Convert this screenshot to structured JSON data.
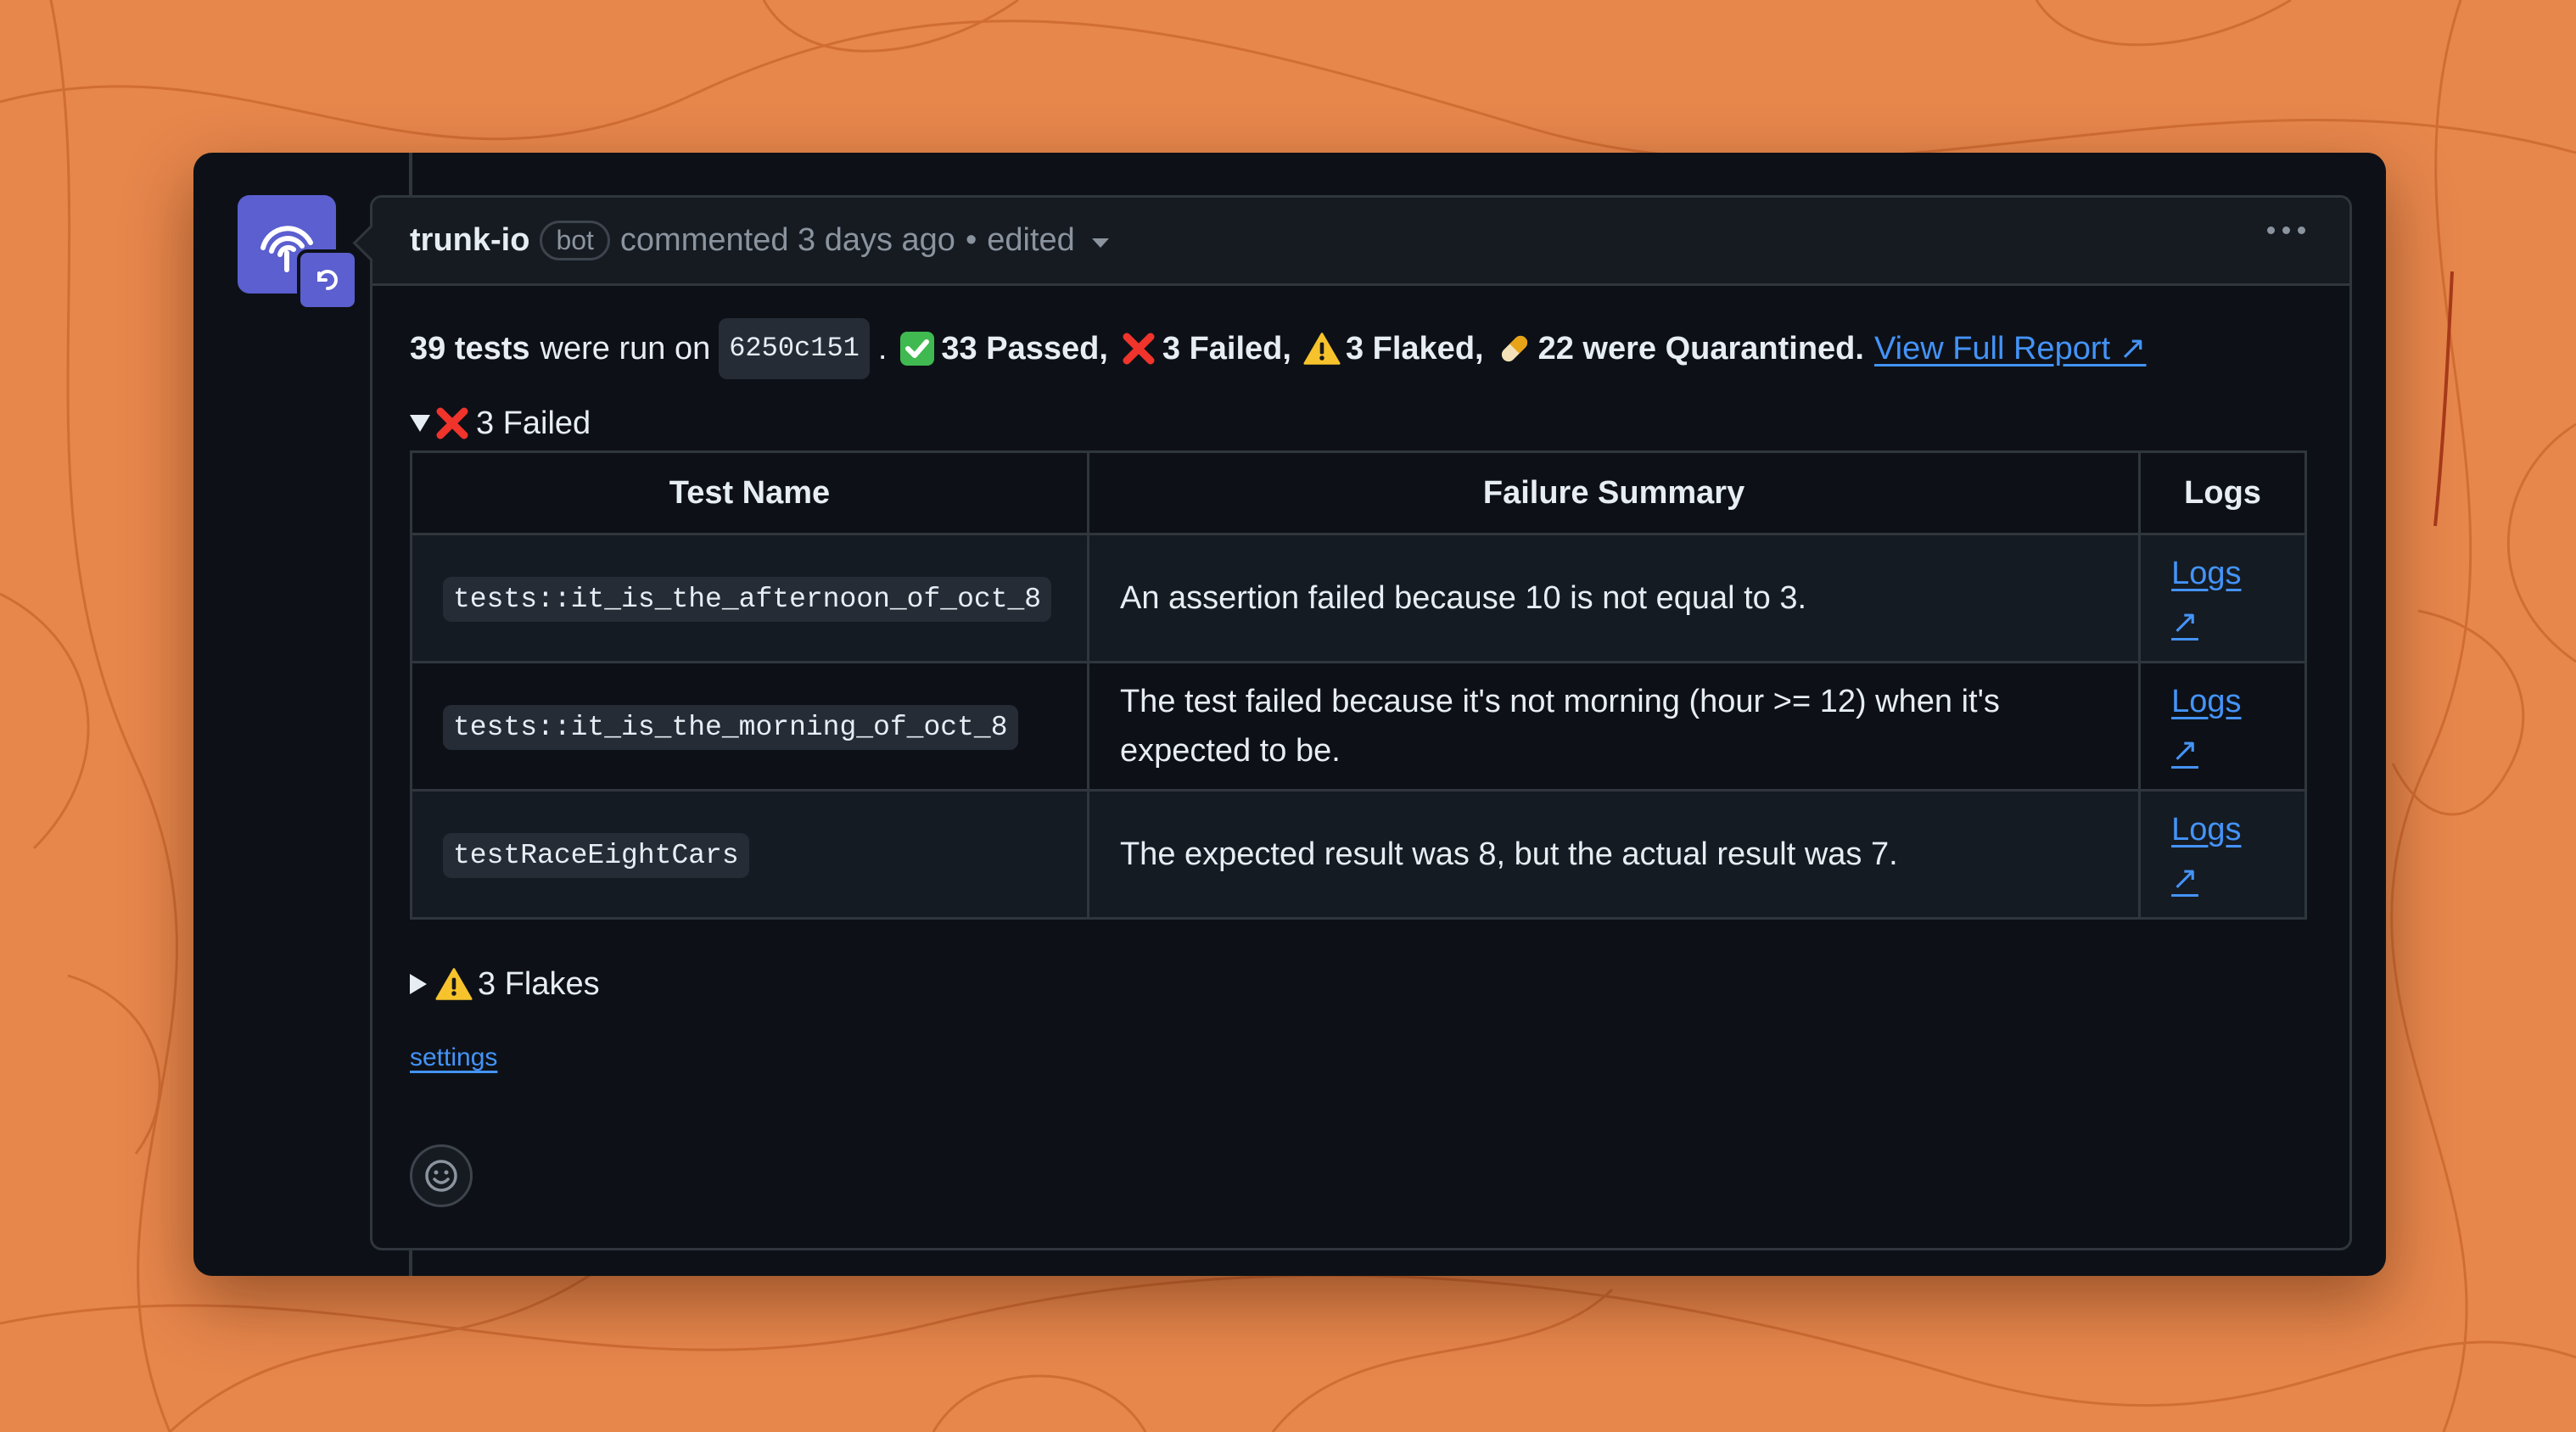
{
  "comment": {
    "author": "trunk-io",
    "badge": "bot",
    "action": "commented 3 days ago",
    "separator": "•",
    "edited": "edited"
  },
  "summary": {
    "count_bold": "39 tests",
    "run_text": "were run on",
    "commit": "6250c151",
    "period": ".",
    "passed": "33 Passed,",
    "failed": "3 Failed,",
    "flaked": "3 Flaked,",
    "quarantined": "22 were Quarantined.",
    "report_link": "View Full Report ↗"
  },
  "failed_section": {
    "label": "3 Failed",
    "columns": [
      "Test Name",
      "Failure Summary",
      "Logs"
    ],
    "rows": [
      {
        "test": "tests::it_is_the_afternoon_of_oct_8",
        "summary": "An assertion failed because 10 is not equal to 3.",
        "logs": "Logs",
        "arrow": "↗"
      },
      {
        "test": "tests::it_is_the_morning_of_oct_8",
        "summary": "The test failed because it's not morning (hour >= 12) when it's expected to be.",
        "logs": "Logs",
        "arrow": "↗"
      },
      {
        "test": "testRaceEightCars",
        "summary": "The expected result was 8, but the actual result was 7.",
        "logs": "Logs",
        "arrow": "↗"
      }
    ]
  },
  "flakes_section": {
    "label": "3 Flakes"
  },
  "settings_link": "settings",
  "icons": {
    "avatar": "trunk-logo-icon",
    "passed": "check-mark-icon",
    "failed": "cross-mark-icon",
    "flaked": "warning-icon",
    "quarantined": "pill-icon",
    "reaction": "smiley-icon",
    "more": "kebab-icon"
  },
  "colors": {
    "background": "#e7874c",
    "card": "#0d1117",
    "link": "#4493f8",
    "avatar": "#5b5fcf"
  }
}
